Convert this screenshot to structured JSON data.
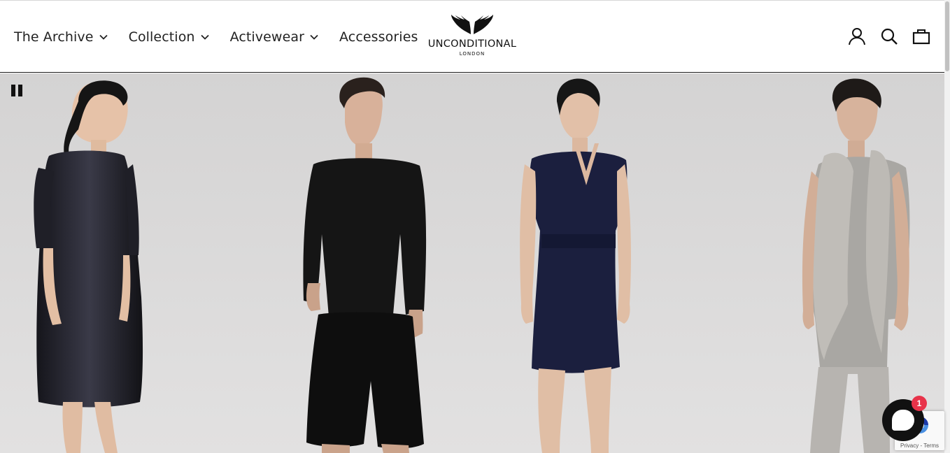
{
  "nav": {
    "items": [
      {
        "label": "The Archive",
        "has_dropdown": true
      },
      {
        "label": "Collection",
        "has_dropdown": true
      },
      {
        "label": "Activewear",
        "has_dropdown": true
      },
      {
        "label": "Accessories",
        "has_dropdown": false
      }
    ]
  },
  "logo": {
    "brand": "UNCONDITIONAL",
    "sub": "LONDON"
  },
  "header_icons": [
    "account-icon",
    "search-icon",
    "cart-icon"
  ],
  "hero": {
    "slideshow_control": "pause-icon",
    "background_color": "#d9d8d8"
  },
  "chat": {
    "badge_count": "1"
  },
  "recaptcha": {
    "privacy": "Privacy",
    "separator": " - ",
    "terms": "Terms"
  },
  "colors": {
    "text": "#222222",
    "chat_badge": "#e8334a"
  }
}
